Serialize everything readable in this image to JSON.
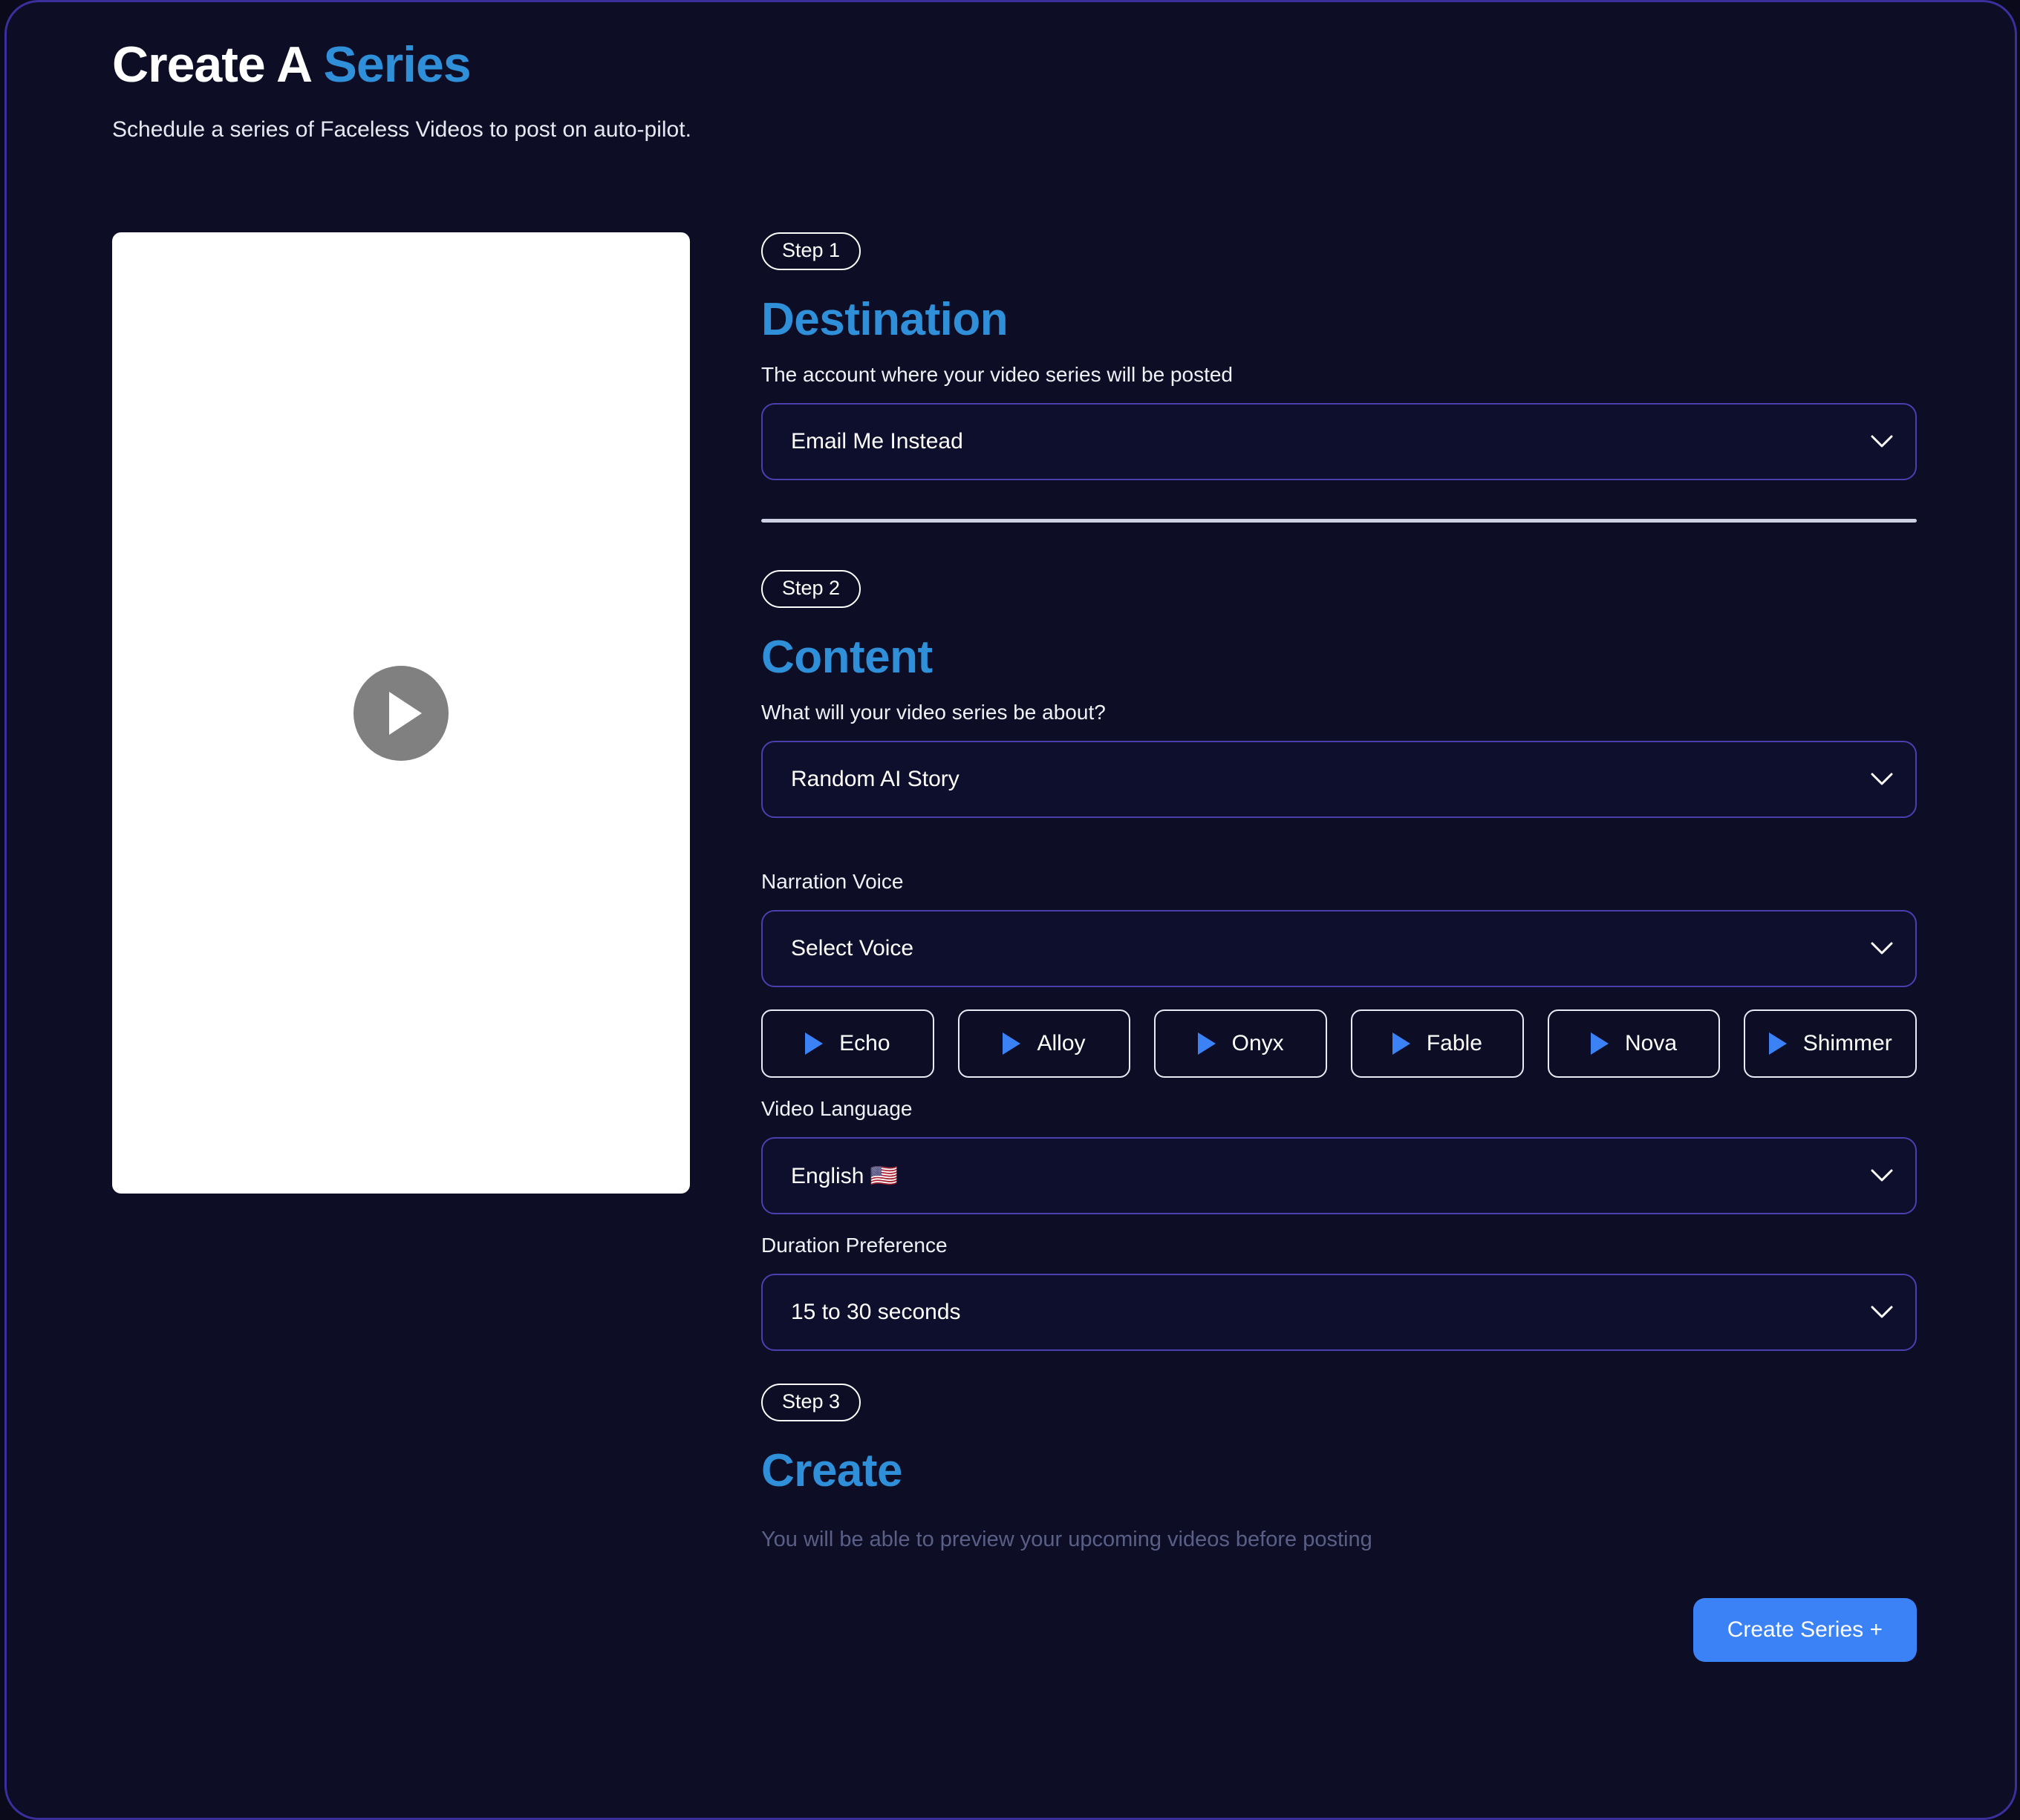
{
  "page": {
    "title_main": "Create A",
    "title_accent": "Series",
    "subtitle": "Schedule a series of Faceless Videos to post on auto-pilot."
  },
  "colors": {
    "background": "#0d0e26",
    "frame_border": "#3b2f9e",
    "accent_heading": "#2f8fd8",
    "select_border": "#4b3fb0",
    "cta": "#3b82f6",
    "voice_triangle": "#3b82f6",
    "play_circle": "#808080",
    "muted_text": "#5a5f86"
  },
  "preview": {
    "play_icon_name": "play-icon"
  },
  "steps": {
    "step1": {
      "badge": "Step 1",
      "heading": "Destination",
      "field_label": "The account where your video series will be posted",
      "select_value": "Email Me Instead"
    },
    "step2": {
      "badge": "Step 2",
      "heading": "Content",
      "topic_label": "What will your video series be about?",
      "topic_value": "Random AI Story",
      "voice_label": "Narration Voice",
      "voice_value": "Select Voice",
      "voices": [
        {
          "label": "Echo"
        },
        {
          "label": "Alloy"
        },
        {
          "label": "Onyx"
        },
        {
          "label": "Fable"
        },
        {
          "label": "Nova"
        },
        {
          "label": "Shimmer"
        }
      ],
      "language_label": "Video Language",
      "language_value": "English 🇺🇸",
      "duration_label": "Duration Preference",
      "duration_value": "15 to 30 seconds"
    },
    "step3": {
      "badge": "Step 3",
      "heading": "Create",
      "note": "You will be able to preview your upcoming videos before posting",
      "cta_label": "Create Series +"
    }
  }
}
